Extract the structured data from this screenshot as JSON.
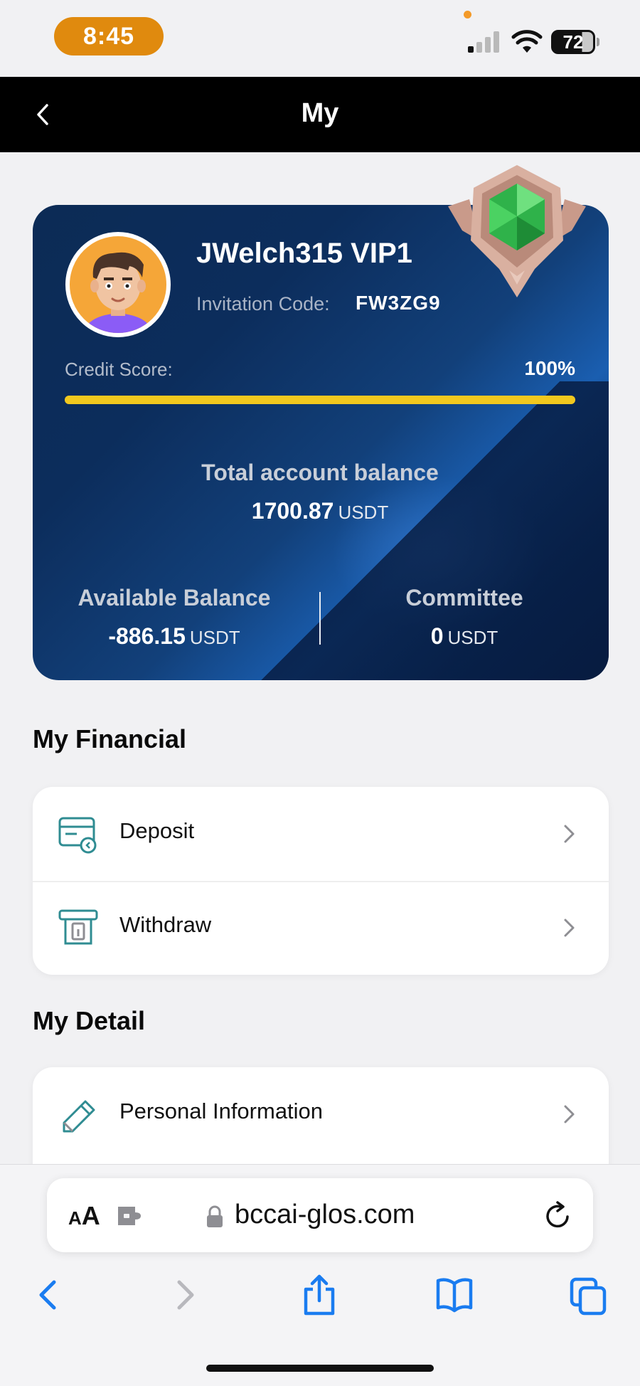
{
  "status_bar": {
    "time": "8:45",
    "battery": "72"
  },
  "header": {
    "title": "My"
  },
  "account": {
    "username": "JWelch315 VIP1",
    "invitation_label": "Invitation Code:",
    "invitation_code": "FW3ZG9",
    "credit_label": "Credit Score:",
    "credit_value": "100%",
    "credit_fraction": 1.0,
    "total_label": "Total account balance",
    "total_amount": "1700.87",
    "available_label": "Available Balance",
    "available_amount": "-886.15",
    "committee_label": "Committee",
    "committee_amount": "0",
    "unit": "USDT"
  },
  "financial": {
    "title": "My Financial",
    "items": [
      {
        "label": "Deposit",
        "icon": "deposit-card-icon"
      },
      {
        "label": "Withdraw",
        "icon": "withdraw-atm-icon"
      }
    ]
  },
  "detail": {
    "title": "My Detail",
    "items": [
      {
        "label": "Personal Information",
        "icon": "pencil-icon"
      }
    ]
  },
  "browser": {
    "text_size_label": "A",
    "text_size_label_large": "A",
    "url": "bccai-glos.com"
  },
  "colors": {
    "accent": "#e08a0e",
    "card_blue": "#0c2d5c",
    "credit_bar": "#f2c81e",
    "icon_teal": "#2f8c92",
    "safari_blue": "#1a7cf0"
  }
}
